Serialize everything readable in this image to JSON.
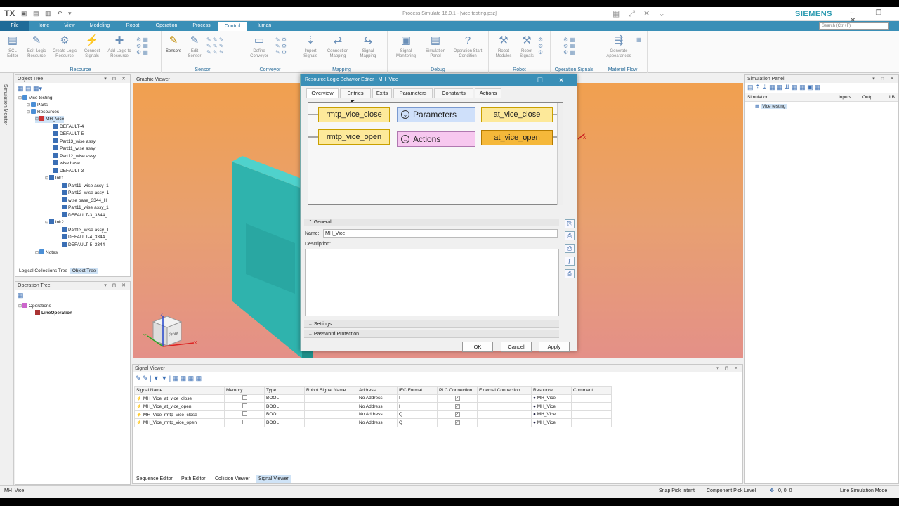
{
  "app": {
    "logo": "TX",
    "title": "Process Simulate 16.0.1 - [vice testing.psz]",
    "brand": "SIEMENS"
  },
  "ribbon_tabs": [
    "File",
    "Home",
    "View",
    "Modeling",
    "Robot",
    "Operation",
    "Process",
    "Control",
    "Human"
  ],
  "active_tab": "Control",
  "search_placeholder": "Search (Ctrl+F)",
  "ribbon_groups": [
    {
      "label": "Resource",
      "buttons": [
        "SCL Editor",
        "Edit Logic Resource",
        "Create Logic Resource",
        "Connect Signals",
        "Add Logic to Resource"
      ]
    },
    {
      "label": "Sensor",
      "buttons": [
        "Sensors",
        "Edit Sensor"
      ]
    },
    {
      "label": "Conveyor",
      "buttons": [
        "Define Conveyor"
      ]
    },
    {
      "label": "Mapping",
      "buttons": [
        "Import Signals",
        "Connection Mapping",
        "Signal Mapping"
      ]
    },
    {
      "label": "Debug",
      "buttons": [
        "Signal Monitoring",
        "Simulation Panel",
        "Operation Start Condition"
      ]
    },
    {
      "label": "Robot",
      "buttons": [
        "Robot Modules",
        "Robot Signals"
      ]
    },
    {
      "label": "Operation Signals",
      "buttons": []
    },
    {
      "label": "Material Flow",
      "buttons": [
        "Generate Appearances"
      ]
    }
  ],
  "side_tab": "Simulation Monitor",
  "object_tree": {
    "title": "Object Tree",
    "items": [
      "Vice testing",
      "Parts",
      "Resources",
      "MH_Vice",
      "DEFAULT-4",
      "DEFAULT-5",
      "Part13_wise assy",
      "Part11_wise assy",
      "Part12_wise assy",
      "wise base",
      "DEFAULT-3",
      "lnk1",
      "Part11_wise assy_1",
      "Part12_wise assy_1",
      "wise base_3344_lll",
      "Part11_wise assy_1",
      "DEFAULT-3_3344_",
      "lnk2",
      "Part13_wise assy_1",
      "DEFAULT-4_3344_",
      "DEFAULT-5_3344_",
      "Notes"
    ],
    "bottom_tabs": [
      "Logical Collections Tree",
      "Object Tree"
    ]
  },
  "operation_tree": {
    "title": "Operation Tree",
    "items": [
      "Operations",
      "LineOperation"
    ]
  },
  "graphic_viewer": {
    "title": "Graphic Viewer",
    "cube_label": "Front"
  },
  "dialog": {
    "title": "Resource Logic Behavior Editor - MH_Vice",
    "tabs": [
      "Overview",
      "Entries",
      "Exits",
      "Parameters",
      "Constants",
      "Actions"
    ],
    "active_tab": "Overview",
    "blocks": {
      "b1": "rmtp_vice_close",
      "b2": "rmtp_vice_open",
      "parameters": "Parameters",
      "actions": "Actions",
      "b3": "at_vice_close",
      "b4": "at_vice_open"
    },
    "general_label": "General",
    "name_label": "Name:",
    "name_value": "MH_Vice",
    "description_label": "Description:",
    "settings_label": "Settings",
    "password_label": "Password Protection",
    "ok": "OK",
    "cancel": "Cancel",
    "apply": "Apply"
  },
  "simulation_panel": {
    "title": "Simulation Panel",
    "cols": [
      "Simulation",
      "Inputs",
      "Outp...",
      "LB"
    ],
    "row": "Vice testing"
  },
  "signal_viewer": {
    "title": "Signal Viewer",
    "columns": [
      "Signal Name",
      "Memory",
      "Type",
      "Robot Signal Name",
      "Address",
      "IEC Format",
      "PLC Connection",
      "External Connection",
      "Resource",
      "Comment"
    ],
    "rows": [
      [
        "MH_Vice_at_vice_close",
        "",
        "BOOL",
        "",
        "No Address",
        "I",
        "✓",
        "",
        "MH_Vice",
        ""
      ],
      [
        "MH_Vice_at_vice_open",
        "",
        "BOOL",
        "",
        "No Address",
        "I",
        "✓",
        "",
        "MH_Vice",
        ""
      ],
      [
        "MH_Vice_rmtp_vice_close",
        "",
        "BOOL",
        "",
        "No Address",
        "Q",
        "✓",
        "",
        "MH_Vice",
        ""
      ],
      [
        "MH_Vice_rmtp_vice_open",
        "",
        "BOOL",
        "",
        "No Address",
        "Q",
        "✓",
        "",
        "MH_Vice",
        ""
      ]
    ],
    "bottom_tabs": [
      "Sequence Editor",
      "Path Editor",
      "Collision Viewer",
      "Signal Viewer"
    ]
  },
  "status": {
    "left": "MH_Vice",
    "snap": "Snap Pick Intent",
    "pick": "Component Pick Level",
    "coords": "0, 0, 0",
    "mode": "Line Simulation Mode"
  },
  "colors": {
    "accent": "#3a8fb7",
    "viewport_top": "#f1a04f",
    "viewport_bottom": "#e49088",
    "block_yellow": "#fde99a",
    "block_orange": "#f5b83a"
  }
}
